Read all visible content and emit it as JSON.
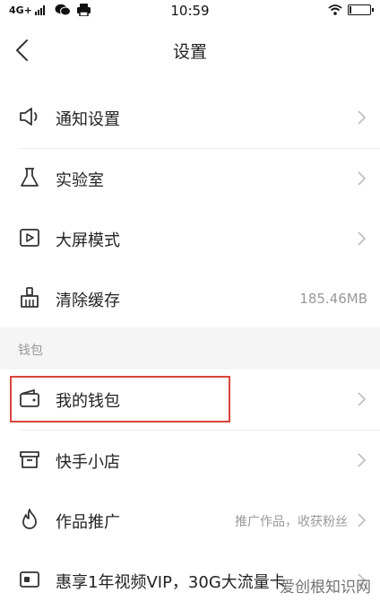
{
  "status_bar": {
    "network": "4G+",
    "time": "10:59"
  },
  "header": {
    "title": "设置"
  },
  "rows_top": [
    {
      "label": "通知设置",
      "icon": "speaker-icon"
    },
    {
      "label": "实验室",
      "icon": "flask-icon"
    },
    {
      "label": "大屏模式",
      "icon": "play-screen-icon"
    },
    {
      "label": "清除缓存",
      "icon": "broom-icon",
      "value": "185.46MB"
    }
  ],
  "wallet_section": {
    "title": "钱包",
    "rows": [
      {
        "label": "我的钱包",
        "icon": "wallet-icon"
      },
      {
        "label": "快手小店",
        "icon": "store-icon"
      },
      {
        "label": "作品推广",
        "icon": "fire-icon",
        "hint": "推广作品，收获粉丝"
      },
      {
        "label": "惠享1年视频VIP，30G大流量卡",
        "icon": "card-icon"
      }
    ]
  },
  "watermark": "爱创根知识网",
  "colors": {
    "highlight": "#d9453a",
    "section_bg": "#f5f5f5",
    "muted_text": "#9a9a9a"
  }
}
